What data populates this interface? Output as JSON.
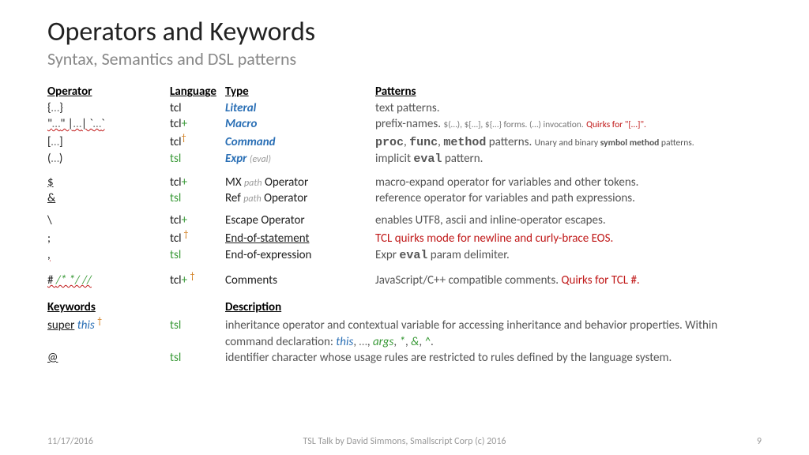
{
  "title": "Operators and Keywords",
  "subtitle": "Syntax, Semantics and DSL patterns",
  "headers": {
    "op": "Operator",
    "lang": "Language",
    "type": "Type",
    "pat": "Patterns"
  },
  "rows": [
    {
      "op": "{…}",
      "lang": "tcl",
      "langExtra": "",
      "dagger": "",
      "type": "Literal",
      "typeStyle": "blue-b",
      "typeExtra": "",
      "pat_plain": "text patterns."
    },
    {
      "op": "\"…\" |…| `…`",
      "opSquig": true,
      "lang": "tcl",
      "langExtra": "+",
      "dagger": "",
      "type": "Macro",
      "typeStyle": "blue-b",
      "typeExtra": "",
      "pat_html": "prefix-names. <span class='grey small'>$(…), $[…], ${…} forms. (…) invocation.</span> <span class='red small'>Quirks for \"[…]\".</span>"
    },
    {
      "op": "[…]",
      "lang": "tcl",
      "langExtra": "",
      "dagger": "†",
      "type": "Command",
      "typeStyle": "blue-b",
      "typeExtra": "",
      "pat_html": "<span class='mono b'>proc</span>, <span class='mono b'>func</span>, <span class='mono b'>method</span> patterns. <span class='small'>Unary and binary <b>symbol method</b> patterns.</span>"
    },
    {
      "op": "(…)",
      "lang": "tsl",
      "langGreen": true,
      "langExtra": "",
      "dagger": "",
      "type": "Expr",
      "typeStyle": "blue-b",
      "typeExtra": "(eval)",
      "pat_html": "implicit <span class='mono b'>eval</span> pattern."
    },
    {
      "sep": true
    },
    {
      "op": "$",
      "opUL": true,
      "lang": "tcl",
      "langExtra": "+",
      "dagger": "",
      "type_html": "MX <span class='lgrey'>path</span> Operator",
      "pat_plain": "macro-expand operator for variables and other tokens."
    },
    {
      "op": "&",
      "opUL": true,
      "lang": "tsl",
      "langGreen": true,
      "langExtra": "",
      "dagger": "",
      "type_html": "Ref <span class='lgrey'>path</span> Operator",
      "pat_plain": "reference operator for variables and path expressions."
    },
    {
      "sep": true
    },
    {
      "op": "\\",
      "lang": "tcl",
      "langExtra": "+",
      "dagger": "",
      "type_plain": "Escape Operator",
      "pat_plain": "enables UTF8, ascii and inline-operator escapes."
    },
    {
      "op": ";",
      "lang": "tcl",
      "langExtra": "",
      "dagger": " †",
      "type_plain": "End-of-statement",
      "typeUL": true,
      "pat_html": "<span class='red'>TCL quirks mode for newline and curly-brace EOS.</span>"
    },
    {
      "op": ",",
      "opSquig": true,
      "lang": "tsl",
      "langGreen": true,
      "langExtra": "",
      "dagger": "",
      "type_plain": "End-of-expression",
      "pat_html": "Expr <span class='mono b'>eval</span> param delimiter."
    },
    {
      "sep": true
    },
    {
      "op_html": "# <span class='green-i'>/* */ //</span>",
      "opSquig": true,
      "lang": "tcl",
      "langExtra": "+ ",
      "dagger": "†",
      "type_plain": "Comments",
      "pat_html": "JavaScript/C++ compatible comments. <span class='red'>Quirks for TCL #.</span>"
    }
  ],
  "kheaders": {
    "kw": "Keywords",
    "desc": "Description"
  },
  "krows": [
    {
      "kw_html": "<span class='ul'>super</span> <span class='blue-i'>this</span> <span class='orange-dag'>†</span>",
      "lang": "tsl",
      "desc_html": "inheritance operator and contextual variable for accessing inheritance and behavior properties. Within command declaration: <span class='blue-i'>this</span>, <span class='grey'>…</span>, <span class='green-i'>args</span>, <span class='green-i'>*</span>, <span class='green-i'>&amp;</span>, <span class='green-i'>^</span>."
    },
    {
      "kw_html": "<span class='ul'>@</span>",
      "lang": "tsl",
      "desc_html": "identifier character whose usage rules are restricted to rules defined by the language system."
    }
  ],
  "footer": {
    "left": "11/17/2016",
    "center": "TSL Talk by David Simmons, Smallscript Corp (c) 2016",
    "right": "9"
  }
}
